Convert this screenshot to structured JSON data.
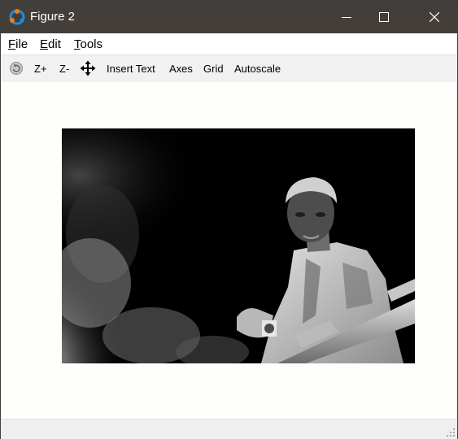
{
  "window": {
    "title": "Figure 2",
    "controls": {
      "minimize_icon": "minimize-icon",
      "maximize_icon": "maximize-icon",
      "close_icon": "close-icon"
    }
  },
  "menu": {
    "file": {
      "mnemonic": "F",
      "rest": "ile"
    },
    "edit": {
      "mnemonic": "E",
      "rest": "dit"
    },
    "tools": {
      "mnemonic": "T",
      "rest": "ools"
    }
  },
  "toolbar": {
    "rotate_icon": "rotate-icon",
    "zoom_in": "Z+",
    "zoom_out": "Z-",
    "pan_icon": "pan-icon",
    "insert_text": "Insert Text",
    "axes": "Axes",
    "grid": "Grid",
    "autoscale": "Autoscale"
  },
  "figure": {
    "content": "inverted grayscale photo of a man leaning on a railing",
    "background": "#000000"
  },
  "colors": {
    "titlebar": "#433e39",
    "canvas": "#fefefa",
    "toolbar": "#f1f1f1"
  }
}
